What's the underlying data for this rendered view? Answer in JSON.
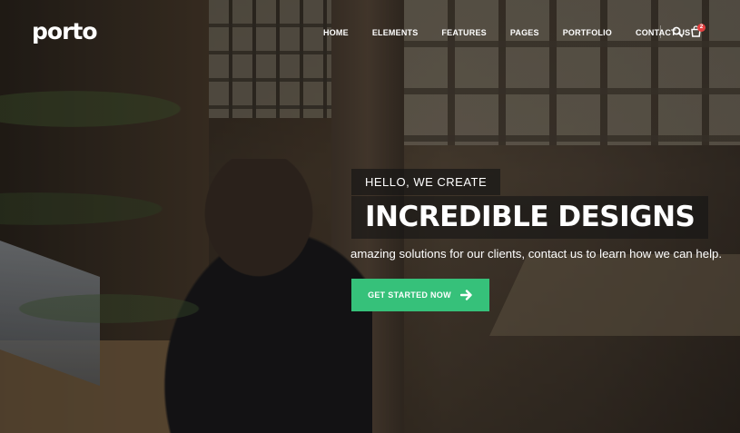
{
  "header": {
    "logo": "porto",
    "nav": [
      "HOME",
      "ELEMENTS",
      "FEATURES",
      "PAGES",
      "PORTFOLIO",
      "CONTACT US"
    ],
    "cart_count": "2",
    "icons": [
      "search-icon",
      "cart-icon"
    ]
  },
  "hero": {
    "kicker": "HELLO, WE CREATE",
    "headline": "INCREDIBLE DESIGNS",
    "subtext": "amazing solutions for our clients, contact us to learn how we can help.",
    "cta_label": "GET STARTED NOW",
    "cta_icon": "arrow-right-icon"
  },
  "colors": {
    "accent": "#36c17a",
    "badge": "#e34040"
  }
}
